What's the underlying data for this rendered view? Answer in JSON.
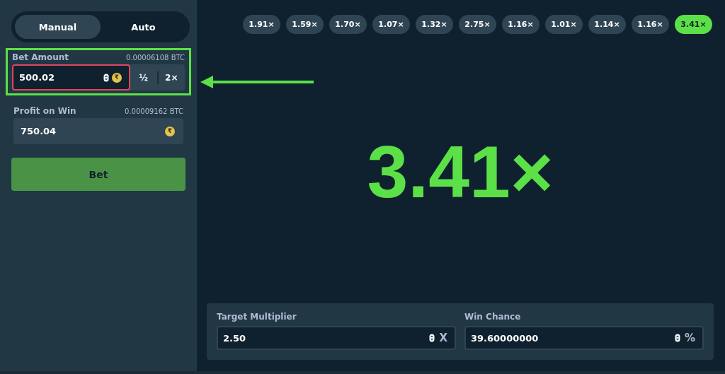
{
  "tabs": [
    {
      "label": "Manual",
      "selected": true
    },
    {
      "label": "Auto",
      "selected": false
    }
  ],
  "bet_amount": {
    "label": "Bet Amount",
    "conversion": "0.00006108 BTC",
    "value": "500.02",
    "currency_symbol": "₹",
    "error": true,
    "buttons": [
      "½",
      "2×"
    ],
    "annotated": true
  },
  "profit_on_win": {
    "label": "Profit on Win",
    "conversion": "0.00009162 BTC",
    "value": "750.04",
    "currency_symbol": "₹"
  },
  "bet_button": "Bet",
  "history": [
    {
      "label": "1.91×",
      "highlighted": false
    },
    {
      "label": "1.59×",
      "highlighted": false
    },
    {
      "label": "1.70×",
      "highlighted": false
    },
    {
      "label": "1.07×",
      "highlighted": false
    },
    {
      "label": "1.32×",
      "highlighted": false
    },
    {
      "label": "2.75×",
      "highlighted": false
    },
    {
      "label": "1.16×",
      "highlighted": false
    },
    {
      "label": "1.01×",
      "highlighted": false
    },
    {
      "label": "1.14×",
      "highlighted": false
    },
    {
      "label": "1.16×",
      "highlighted": false
    },
    {
      "label": "3.41×",
      "highlighted": true
    }
  ],
  "result": "3.41×",
  "fields": [
    {
      "label": "Target Multiplier",
      "value": "2.50",
      "suffix": "X"
    },
    {
      "label": "Win Chance",
      "value": "39.60000000",
      "suffix": "%"
    }
  ]
}
